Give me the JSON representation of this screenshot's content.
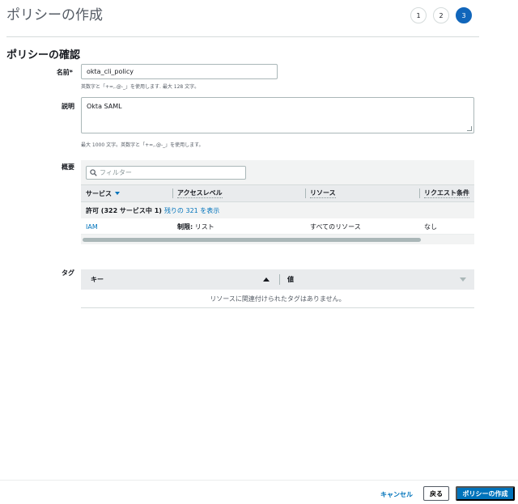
{
  "header": {
    "title": "ポリシーの作成",
    "steps": [
      "1",
      "2",
      "3"
    ]
  },
  "review": {
    "title": "ポリシーの確認",
    "name": {
      "label": "名前*",
      "value": "okta_cli_policy",
      "hint": "英数字と「+=,.@-_」を使用します. 最大 128 文字。"
    },
    "description": {
      "label": "説明",
      "value": "Okta SAML",
      "hint": "最大 1000 文字。英数字と「+=,.@-_」を使用します。"
    },
    "summary": {
      "label": "概要",
      "filter_placeholder": "フィルター",
      "columns": [
        "サービス",
        "アクセスレベル",
        "リソース",
        "リクエスト条件"
      ],
      "group": {
        "label": "許可 (322 サービス中 1)",
        "link": "残りの 321 を表示"
      },
      "rows": [
        {
          "service": "IAM",
          "access_prefix": "制限:",
          "access": " リスト",
          "resource": "すべてのリソース",
          "condition": "なし"
        }
      ]
    },
    "tags": {
      "label": "タグ",
      "columns": [
        "キー",
        "値"
      ],
      "empty_message": "リソースに関連付けられたタグはありません。"
    }
  },
  "footer": {
    "cancel": "キャンセル",
    "back": "戻る",
    "create": "ポリシーの作成"
  },
  "colors": {
    "primary": "#0073bb",
    "step_active": "#1166bb"
  }
}
